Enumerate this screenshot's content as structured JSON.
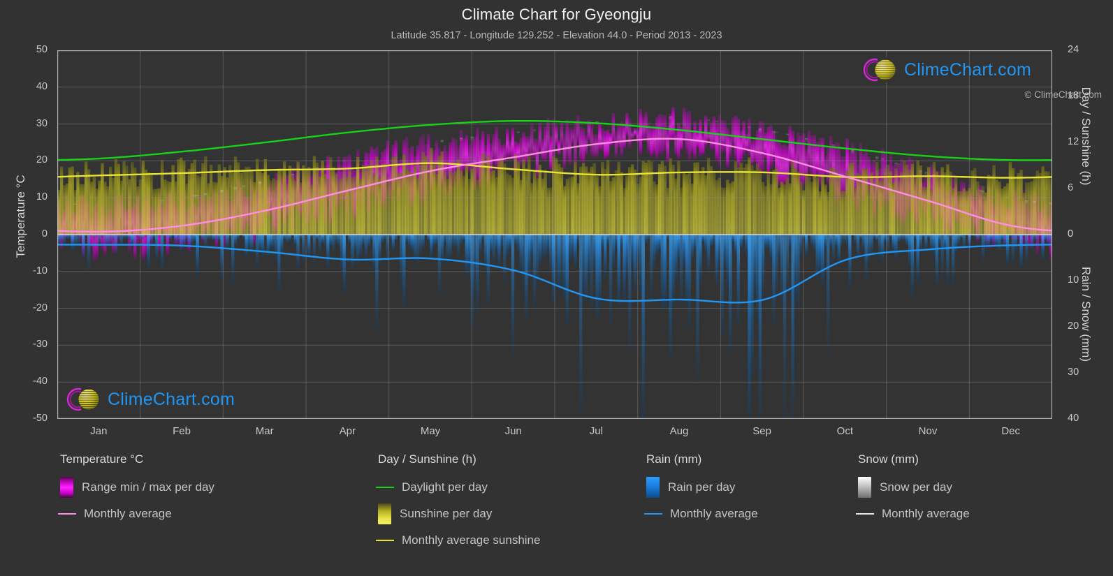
{
  "header": {
    "title": "Climate Chart for Gyeongju",
    "subtitle": "Latitude 35.817 - Longitude 129.252 - Elevation 44.0 - Period 2013 - 2023"
  },
  "axes": {
    "left_title": "Temperature °C",
    "right_title_top": "Day / Sunshine (h)",
    "right_title_bottom": "Rain / Snow (mm)",
    "left_ticks": [
      "50",
      "40",
      "30",
      "20",
      "10",
      "0",
      "-10",
      "-20",
      "-30",
      "-40",
      "-50"
    ],
    "right_ticks_top": [
      "24",
      "18",
      "12",
      "6",
      "0"
    ],
    "right_ticks_bottom": [
      "0",
      "10",
      "20",
      "30",
      "40"
    ],
    "x_ticks": [
      "Jan",
      "Feb",
      "Mar",
      "Apr",
      "May",
      "Jun",
      "Jul",
      "Aug",
      "Sep",
      "Oct",
      "Nov",
      "Dec"
    ]
  },
  "legend": {
    "groups": [
      {
        "title": "Temperature °C",
        "items": [
          {
            "label": "Range min / max per day",
            "marker": "swatch-temperature"
          },
          {
            "label": "Monthly average",
            "marker": "line-temperature",
            "color": "#ff8fe0"
          }
        ]
      },
      {
        "title": "Day / Sunshine (h)",
        "items": [
          {
            "label": "Daylight per day",
            "marker": "line-daylight",
            "color": "#19d119"
          },
          {
            "label": "Sunshine per day",
            "marker": "swatch-sunshine"
          },
          {
            "label": "Monthly average sunshine",
            "marker": "line-sunshine",
            "color": "#e8e436"
          }
        ]
      },
      {
        "title": "Rain (mm)",
        "items": [
          {
            "label": "Rain per day",
            "marker": "swatch-rain"
          },
          {
            "label": "Monthly average",
            "marker": "line-rain",
            "color": "#2196f3"
          }
        ]
      },
      {
        "title": "Snow (mm)",
        "items": [
          {
            "label": "Snow per day",
            "marker": "swatch-snow"
          },
          {
            "label": "Monthly average",
            "marker": "line-snow",
            "color": "#e8e8e8"
          }
        ]
      }
    ],
    "copyright": "© ClimeChart.com"
  },
  "watermark": {
    "text": "ClimeChart.com"
  },
  "colors": {
    "background": "#323232",
    "plot_background": "#333333",
    "grid": "#8f8f8f",
    "temperature_line": "#ff8fe0",
    "temperature_range": "#e000e0",
    "daylight_line": "#19d119",
    "sunshine_line": "#e8e436",
    "sunshine_fill": "#c4bf2e",
    "rain_line": "#2196f3",
    "rain_fill": "#1a7fe0",
    "snow_fill": "#d8d8d8"
  },
  "chart_data": {
    "type": "line",
    "title": "Climate Chart for Gyeongju",
    "subtitle": "Latitude 35.817 - Longitude 129.252 - Elevation 44.0 - Period 2013 - 2023",
    "xlabel": "",
    "ylabel": "Temperature °C",
    "ylabel_right_top": "Day / Sunshine (h)",
    "ylabel_right_bottom": "Rain / Snow (mm)",
    "ylim": [
      -50,
      50
    ],
    "ylim_right_top": [
      0,
      24
    ],
    "ylim_right_bottom": [
      0,
      40
    ],
    "grid": true,
    "legend_position": "below",
    "categories": [
      "Jan",
      "Feb",
      "Mar",
      "Apr",
      "May",
      "Jun",
      "Jul",
      "Aug",
      "Sep",
      "Oct",
      "Nov",
      "Dec"
    ],
    "series": [
      {
        "name": "Monthly average temperature",
        "unit": "°C",
        "axis": "left",
        "color": "#ff8fe0",
        "values": [
          0.8,
          2.4,
          6.5,
          12.0,
          17.3,
          21.0,
          24.6,
          25.9,
          22.0,
          15.6,
          9.0,
          2.3
        ]
      },
      {
        "name": "Daylight per day",
        "unit": "h",
        "axis": "right-top",
        "color": "#19d119",
        "values": [
          9.9,
          10.8,
          12.0,
          13.3,
          14.3,
          14.8,
          14.5,
          13.6,
          12.4,
          11.2,
          10.2,
          9.7
        ]
      },
      {
        "name": "Monthly average sunshine",
        "unit": "h",
        "axis": "right-top",
        "color": "#e8e436",
        "values": [
          7.7,
          8.0,
          8.4,
          8.6,
          9.3,
          8.5,
          7.8,
          8.1,
          8.1,
          7.5,
          7.6,
          7.4
        ]
      },
      {
        "name": "Monthly average rain",
        "unit": "mm",
        "axis": "right-bottom",
        "color": "#2196f3",
        "values": [
          2.2,
          2.4,
          3.7,
          5.4,
          5.2,
          7.8,
          13.9,
          14.1,
          14.1,
          5.4,
          3.2,
          2.3
        ]
      },
      {
        "name": "Monthly average snow",
        "unit": "mm",
        "axis": "right-bottom",
        "color": "#e8e8e8",
        "values": [
          0.0,
          0.0,
          0.0,
          0.0,
          0.0,
          0.0,
          0.0,
          0.0,
          0.0,
          0.0,
          0.0,
          0.0
        ]
      },
      {
        "name": "Temperature range min per day",
        "unit": "°C",
        "axis": "left",
        "color": "#e000e0",
        "values": [
          -4.0,
          -2.6,
          1.3,
          6.5,
          12.0,
          17.2,
          21.6,
          22.6,
          17.6,
          10.1,
          3.6,
          -2.5
        ]
      },
      {
        "name": "Temperature range max per day",
        "unit": "°C",
        "axis": "left",
        "color": "#e000e0",
        "values": [
          6.8,
          8.7,
          13.2,
          19.0,
          23.7,
          26.3,
          29.2,
          30.5,
          27.1,
          22.0,
          15.2,
          8.4
        ]
      },
      {
        "name": "Sunshine per day",
        "unit": "h",
        "axis": "right-top",
        "color": "#c4bf2e",
        "values": [
          7.7,
          8.0,
          8.4,
          8.6,
          9.3,
          8.5,
          7.8,
          8.1,
          8.1,
          7.5,
          7.6,
          7.4
        ]
      },
      {
        "name": "Rain per day",
        "unit": "mm",
        "axis": "right-bottom",
        "color": "#1a7fe0",
        "values": [
          2.2,
          2.4,
          3.7,
          5.4,
          5.2,
          7.8,
          13.9,
          14.1,
          14.1,
          5.4,
          3.2,
          2.3
        ]
      }
    ]
  }
}
